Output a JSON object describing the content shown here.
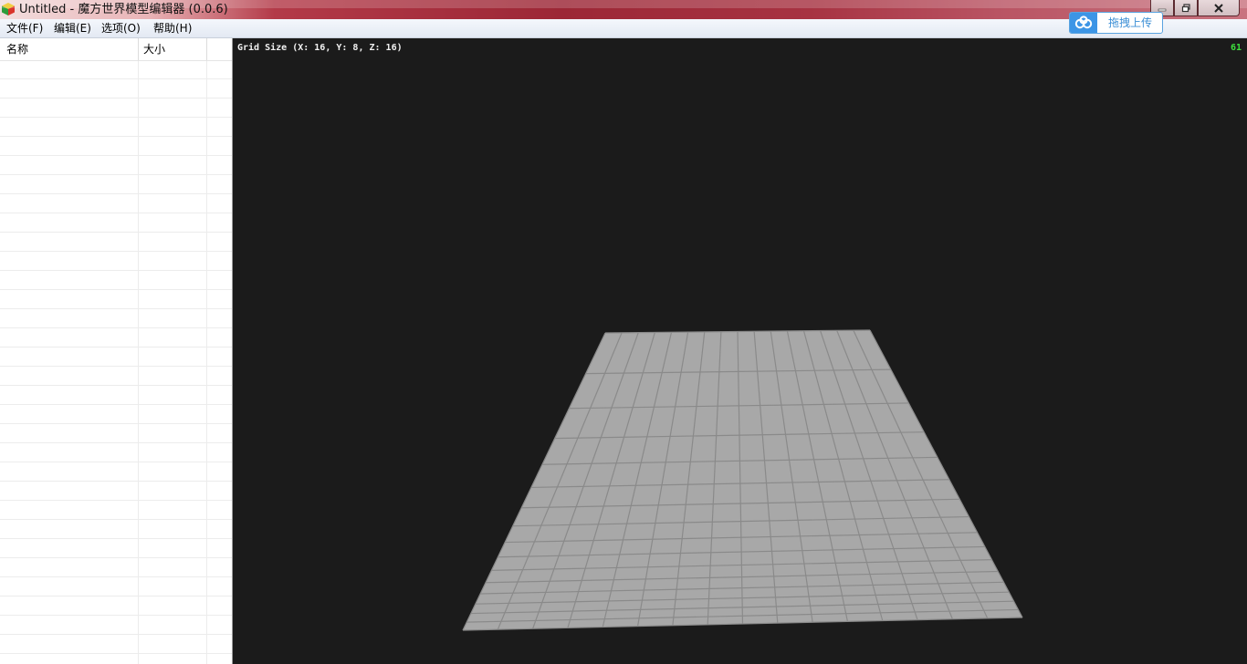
{
  "window": {
    "title": "Untitled - 魔方世界模型编辑器 (0.0.6)",
    "controls": {
      "minimize_icon": "minimize-icon",
      "maximize_icon": "restore-icon",
      "close_icon": "close-icon"
    }
  },
  "menubar": {
    "items": [
      {
        "label": "文件(F)"
      },
      {
        "label": "编辑(E)"
      },
      {
        "label": "选项(O)"
      },
      {
        "label": "帮助(H)"
      }
    ]
  },
  "upload": {
    "label": "拖拽上传",
    "icon": "cloud-upload-icon",
    "color": "#3c95e6"
  },
  "filelist": {
    "columns": [
      {
        "label": "名称"
      },
      {
        "label": "大小"
      }
    ],
    "rows": []
  },
  "viewport": {
    "grid_info": "Grid Size (X: 16, Y: 8, Z: 16)",
    "fps": "61",
    "grid": {
      "x": 16,
      "z": 16
    },
    "colors": {
      "background": "#1b1b1b",
      "plane": "#a8a8a8",
      "lines": "#8a8a8a",
      "fps": "#3ee03e"
    }
  }
}
